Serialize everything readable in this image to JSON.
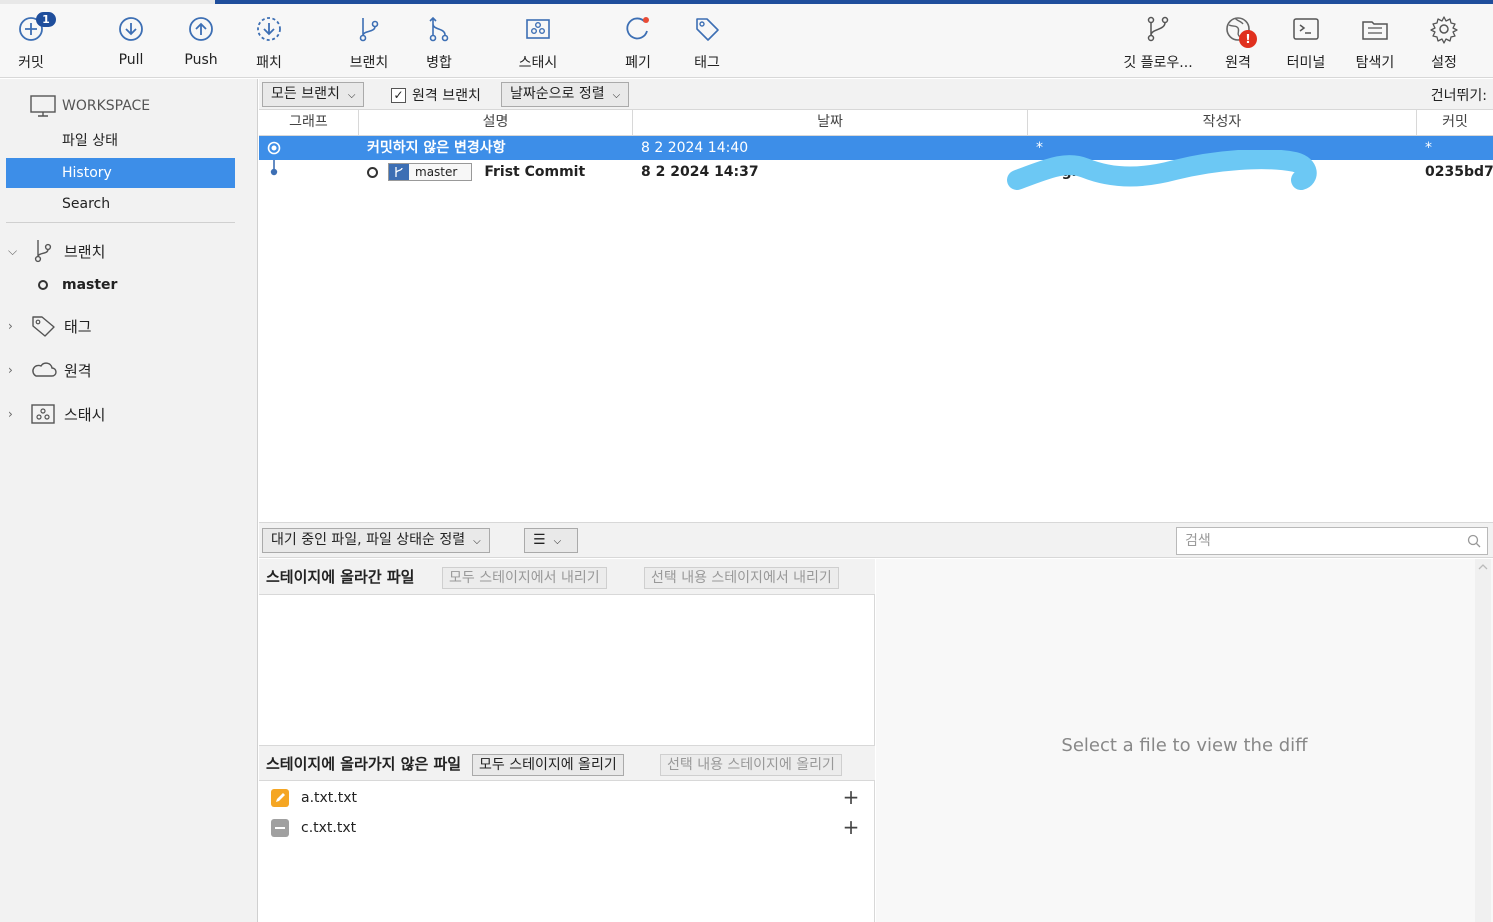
{
  "toolbar": {
    "commit": {
      "label": "커밋",
      "badge": "1",
      "icon": "plus-circle-icon"
    },
    "pull": {
      "label": "Pull",
      "icon": "arrow-down-circle-icon"
    },
    "push": {
      "label": "Push",
      "icon": "arrow-up-circle-icon"
    },
    "fetch": {
      "label": "패치",
      "icon": "dashed-arrow-down-circle-icon"
    },
    "branch": {
      "label": "브랜치",
      "icon": "branch-icon"
    },
    "merge": {
      "label": "병합",
      "icon": "merge-icon"
    },
    "stash": {
      "label": "스태시",
      "icon": "stash-icon"
    },
    "discard": {
      "label": "폐기",
      "icon": "discard-icon"
    },
    "tag": {
      "label": "태그",
      "icon": "tag-icon"
    },
    "gitflow": {
      "label": "깃 플로우...",
      "icon": "gitflow-icon"
    },
    "remote": {
      "label": "원격",
      "alert": "!",
      "icon": "globe-icon"
    },
    "terminal": {
      "label": "터미널",
      "icon": "terminal-icon"
    },
    "explorer": {
      "label": "탐색기",
      "icon": "folder-icon"
    },
    "settings": {
      "label": "설정",
      "icon": "gear-icon"
    }
  },
  "sidebar": {
    "workspace": "WORKSPACE",
    "items": [
      {
        "label": "파일 상태"
      },
      {
        "label": "History"
      },
      {
        "label": "Search"
      }
    ],
    "groups": {
      "branches": "브랜치",
      "tags": "태그",
      "remotes": "원격",
      "stashes": "스태시"
    },
    "current_branch": "master"
  },
  "filters": {
    "branches": "모든 브랜치",
    "remote_branches": "원격 브랜치",
    "sort": "날짜순으로 정렬",
    "skip": "건너뛰기:"
  },
  "history": {
    "columns": [
      "그래프",
      "설명",
      "날짜",
      "작성자",
      "커밋"
    ],
    "rows": [
      {
        "description": "커밋하지 않은 변경사항",
        "date": "8 2 2024 14:40",
        "author": "*",
        "commit": "*"
      },
      {
        "branch_tag": "master",
        "description": "Frist Commit",
        "date": "8 2 2024 14:37",
        "author": "ligh",
        "commit": "0235bd7"
      }
    ]
  },
  "files": {
    "sort": "대기 중인 파일, 파일 상태순 정렬",
    "view_icon": "list-icon",
    "search_placeholder": "검색",
    "staged": {
      "title": "스테이지에 올라간 파일",
      "unstage_all": "모두 스테이지에서 내리기",
      "unstage_selected": "선택 내용 스테이지에서 내리기"
    },
    "unstaged": {
      "title": "스테이지에 올라가지 않은 파일",
      "stage_all": "모두 스테이지에 올리기",
      "stage_selected": "선택 내용 스테이지에 올리기",
      "items": [
        {
          "name": "a.txt.txt",
          "status": "modified",
          "color": "#f5a623"
        },
        {
          "name": "c.txt.txt",
          "status": "removed",
          "color": "#a0a0a0"
        }
      ]
    },
    "diff_placeholder": "Select a file to view the diff"
  },
  "colors": {
    "accent": "#3d8ee8",
    "toolbar_icon": "#3d6fb4",
    "alert": "#e0301e"
  }
}
